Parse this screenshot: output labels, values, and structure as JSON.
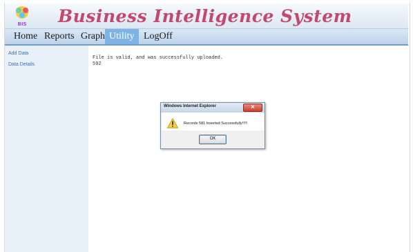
{
  "header": {
    "title": "Business Intelligence System",
    "logo_icon": "bis-logo-icon"
  },
  "nav": {
    "items": [
      {
        "label": "Home"
      },
      {
        "label": "Reports"
      },
      {
        "label": "Graph"
      },
      {
        "label": "Utility",
        "active": true
      },
      {
        "label": "LogOff"
      }
    ],
    "active_color": "#7fb3e6"
  },
  "sidebar": {
    "items": [
      {
        "label": "Add Data"
      },
      {
        "label": "Data Details"
      }
    ]
  },
  "content": {
    "status_line": "File is valid, and was successfully uploaded.",
    "count": "592"
  },
  "dialog": {
    "title": "Windows Internet Explorer",
    "message": "Records 581 Inserted Successfully!!!!!",
    "ok_label": "OK",
    "icon": "warning-icon"
  }
}
